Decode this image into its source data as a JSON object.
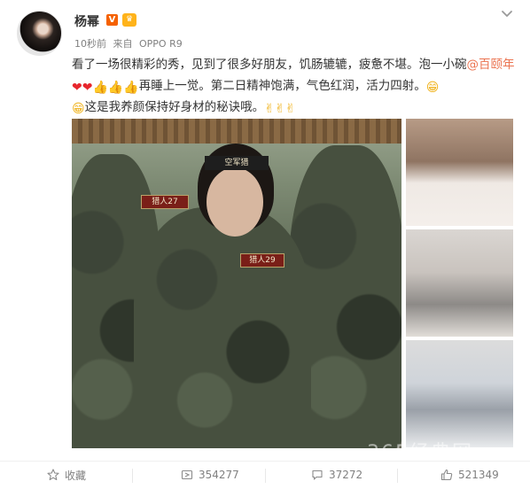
{
  "post": {
    "user_name": "杨幂",
    "verified_badge": "V",
    "member_badge": "♛",
    "time": "10秒前",
    "source_prefix": "来自",
    "source": "OPPO R9",
    "text_line1_a": "看了一场很精彩的秀，见到了很多好朋友，饥肠辘辘，疲惫不堪。泡一小碗",
    "mention": "@百颐年",
    "text_line2_a": "再睡上一觉。第二日精神饱满，气色红润，活力四射。",
    "text_line3": "这是我养颜保持好身材的秘诀哦。",
    "emoji": {
      "heart": "❤",
      "thumb": "👍",
      "smile": "😁",
      "victory": "✌"
    }
  },
  "images": {
    "main_patch_left": "猎人27",
    "main_patch_center": "猎人29",
    "headband_text": "空军猎"
  },
  "watermark": "365经典网",
  "actions": {
    "favorite_label": "收藏",
    "repost_count": "354277",
    "comment_count": "37272",
    "like_count": "521349"
  },
  "colors": {
    "link": "#eb7350",
    "meta": "#808080",
    "vip": "#f56100"
  }
}
